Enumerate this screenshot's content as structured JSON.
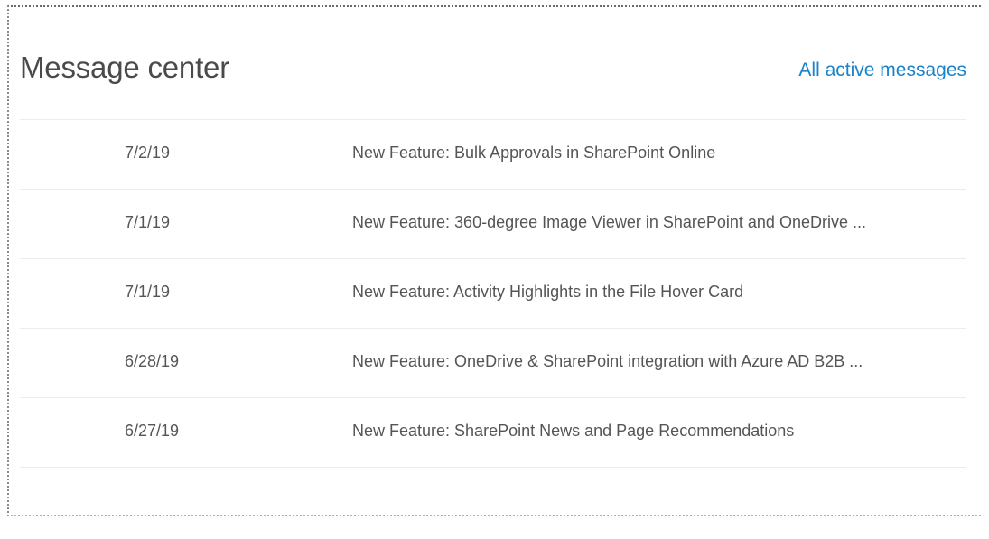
{
  "message_center": {
    "title": "Message center",
    "all_link": "All active messages",
    "messages": [
      {
        "date": "7/2/19",
        "text": "New Feature: Bulk Approvals in SharePoint Online"
      },
      {
        "date": "7/1/19",
        "text": "New Feature: 360-degree Image Viewer in SharePoint and OneDrive ..."
      },
      {
        "date": "7/1/19",
        "text": "New Feature: Activity Highlights in the File Hover Card"
      },
      {
        "date": "6/28/19",
        "text": "New Feature: OneDrive & SharePoint integration with Azure AD B2B ..."
      },
      {
        "date": "6/27/19",
        "text": "New Feature: SharePoint News and Page Recommendations"
      }
    ]
  },
  "colors": {
    "link": "#1a82c9",
    "text": "#555555",
    "divider": "#ececec"
  }
}
